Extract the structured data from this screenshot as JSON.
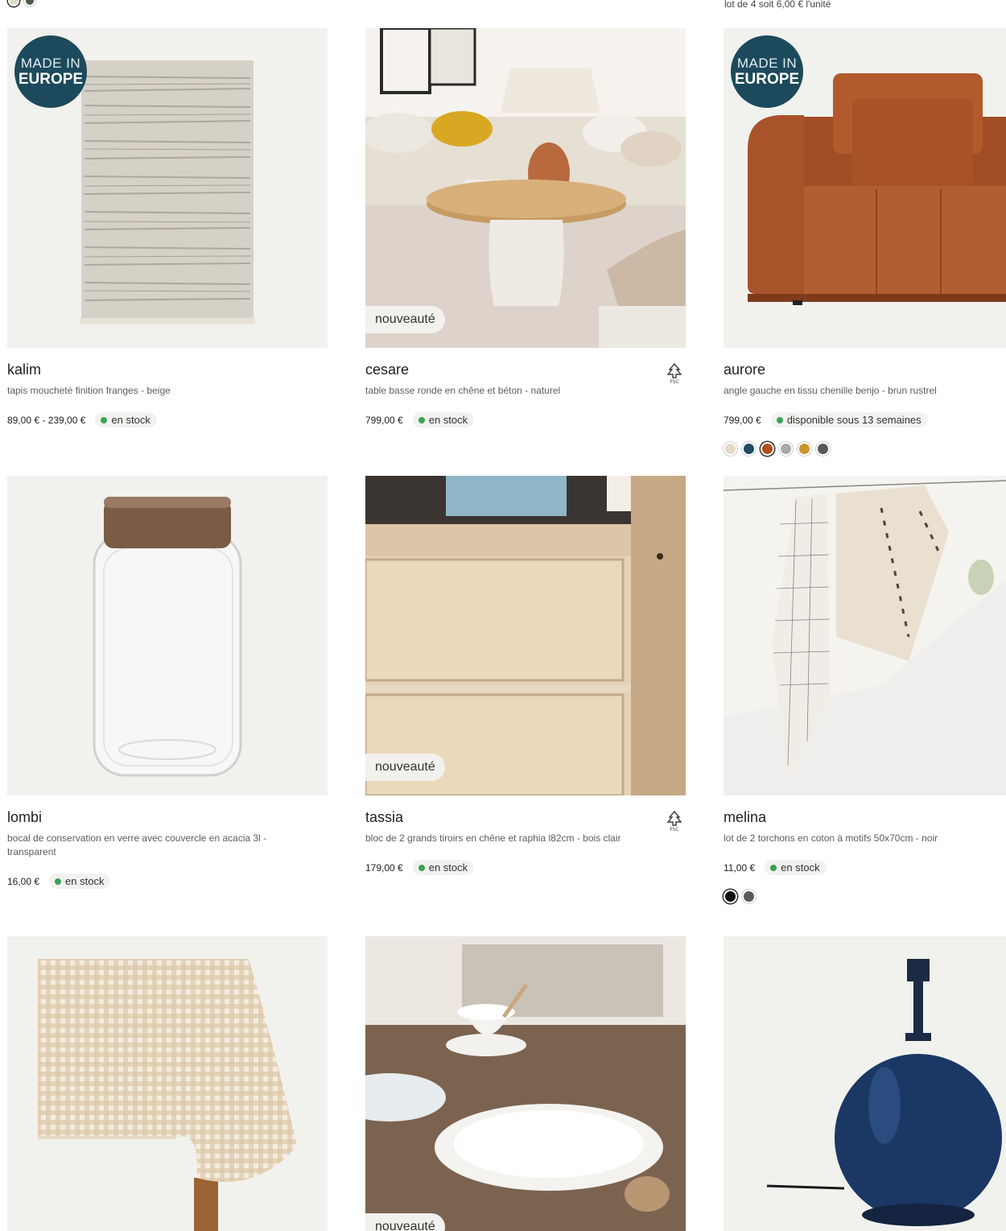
{
  "top": {
    "swatch_colors": [
      "#e2d9c9",
      "#4e5a4a"
    ],
    "note": "lot de 4 soit 6,00 € l'unité"
  },
  "badges": {
    "europe_line1": "MADE IN",
    "europe_line2": "EUROPE",
    "new": "nouveauté"
  },
  "products": [
    {
      "name": "kalim",
      "desc": "tapis moucheté finition franges - beige",
      "price": "89,00 € - 239,00 €",
      "stock": "en stock",
      "swatches": []
    },
    {
      "name": "cesare",
      "desc": "table basse ronde en chêne et béton - naturel",
      "price": "799,00 €",
      "stock": "en stock",
      "fsc_icon": "fsc-icon",
      "swatches": []
    },
    {
      "name": "aurore",
      "desc": "angle gauche en tissu chenille benjo - brun rustrel",
      "price": "799,00 €",
      "stock": "disponible sous 13 semaines",
      "swatches": [
        "#e2d9c9",
        "#1f4d63",
        "#b24d1c",
        "#a7a9ad",
        "#c9982b",
        "#555b57"
      ],
      "selected_swatch": 2
    },
    {
      "name": "lombi",
      "desc": "bocal de conservation en verre avec couvercle en acacia 3l - transparent",
      "price": "16,00 €",
      "stock": "en stock",
      "swatches": []
    },
    {
      "name": "tassia",
      "desc": "bloc de 2 grands tiroirs en chêne et raphia l82cm - bois clair",
      "price": "179,00 €",
      "stock": "en stock",
      "fsc_icon": "fsc-icon",
      "swatches": []
    },
    {
      "name": "melina",
      "desc": "lot de 2 torchons en coton à motifs 50x70cm - noir",
      "price": "11,00 €",
      "stock": "en stock",
      "swatches": [
        "#111111",
        "#555b57"
      ],
      "selected_swatch": 0
    }
  ]
}
